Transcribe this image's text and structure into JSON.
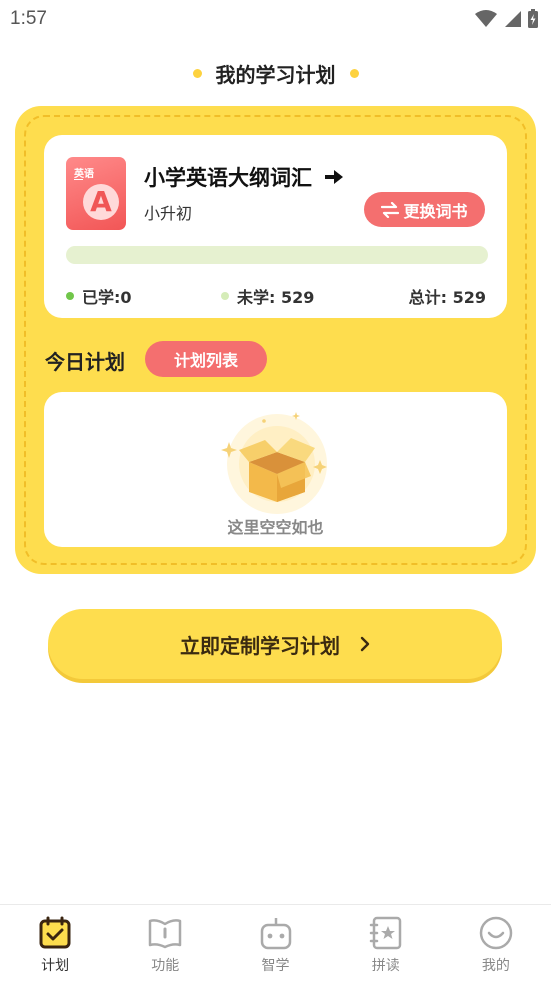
{
  "status_bar": {
    "time": "1:57"
  },
  "header": {
    "title": "我的学习计划"
  },
  "book": {
    "cover_label": "英语",
    "cover_letter": "A",
    "title": "小学英语大纲词汇",
    "subtitle": "小升初",
    "change_button": "更换词书",
    "progress_fraction": 0,
    "stats": {
      "learned": "已学:0",
      "unlearned": "未学: 529",
      "total": "总计: 529"
    }
  },
  "today": {
    "label": "今日计划",
    "plan_list_button": "计划列表",
    "empty_text": "这里空空如也"
  },
  "custom_plan_button": "立即定制学习计划",
  "tabs": [
    {
      "label": "计划",
      "icon": "calendar-check-icon",
      "active": true
    },
    {
      "label": "功能",
      "icon": "book-icon",
      "active": false
    },
    {
      "label": "智学",
      "icon": "robot-icon",
      "active": false
    },
    {
      "label": "拼读",
      "icon": "star-book-icon",
      "active": false
    },
    {
      "label": "我的",
      "icon": "smile-icon",
      "active": false
    }
  ],
  "colors": {
    "accent_yellow": "#FEDD4E",
    "accent_red": "#F46F6F",
    "learned_dot": "#71C64A",
    "unlearned_dot": "#D5ECB8"
  }
}
